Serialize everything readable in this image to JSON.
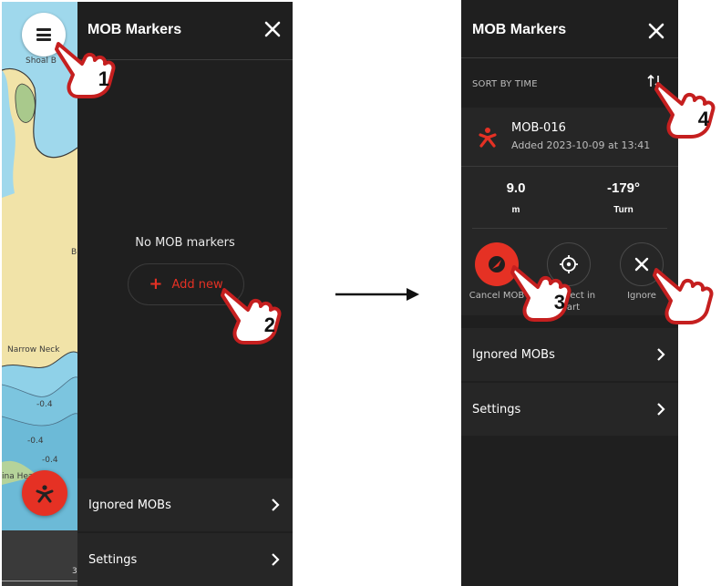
{
  "left": {
    "map_labels": [
      "Shoal B",
      "Narrow Neck",
      "-0.4",
      "-0.4",
      "-0.4",
      "ina Head",
      "B",
      "3"
    ],
    "panel_title": "MOB Markers",
    "empty_text": "No MOB markers",
    "add_new": "Add new",
    "ignored_mobs": "Ignored MOBs",
    "settings": "Settings"
  },
  "right": {
    "panel_title": "MOB Markers",
    "sort_label": "SORT BY TIME",
    "mob": {
      "name": "MOB-016",
      "added": "Added 2023-10-09 at 13:41",
      "distance_value": "9.0",
      "distance_unit": "m",
      "bearing_value": "-179°",
      "bearing_unit": "Turn"
    },
    "actions": {
      "cancel": "Cancel MOB",
      "select": "Select in chart",
      "ignore": "Ignore"
    },
    "ignored_mobs": "Ignored MOBs",
    "settings": "Settings"
  },
  "callouts": [
    "1",
    "2",
    "3",
    "4"
  ],
  "icons": {
    "menu": "hamburger-icon",
    "close": "close-icon",
    "add": "plus-icon",
    "chevron": "chevron-right-icon",
    "sort": "sort-arrows-icon",
    "mob": "mob-person-icon",
    "compass": "compass-arrow-icon",
    "crosshair": "crosshair-icon",
    "hand": "pointing-hand-icon",
    "arrow": "arrow-right-icon"
  },
  "colors": {
    "accent_red": "#e53124",
    "panel_bg": "#1f1f1f",
    "row_bg": "#262626",
    "map_land": "#f1e3a8",
    "map_water": "#8fd1e8"
  }
}
